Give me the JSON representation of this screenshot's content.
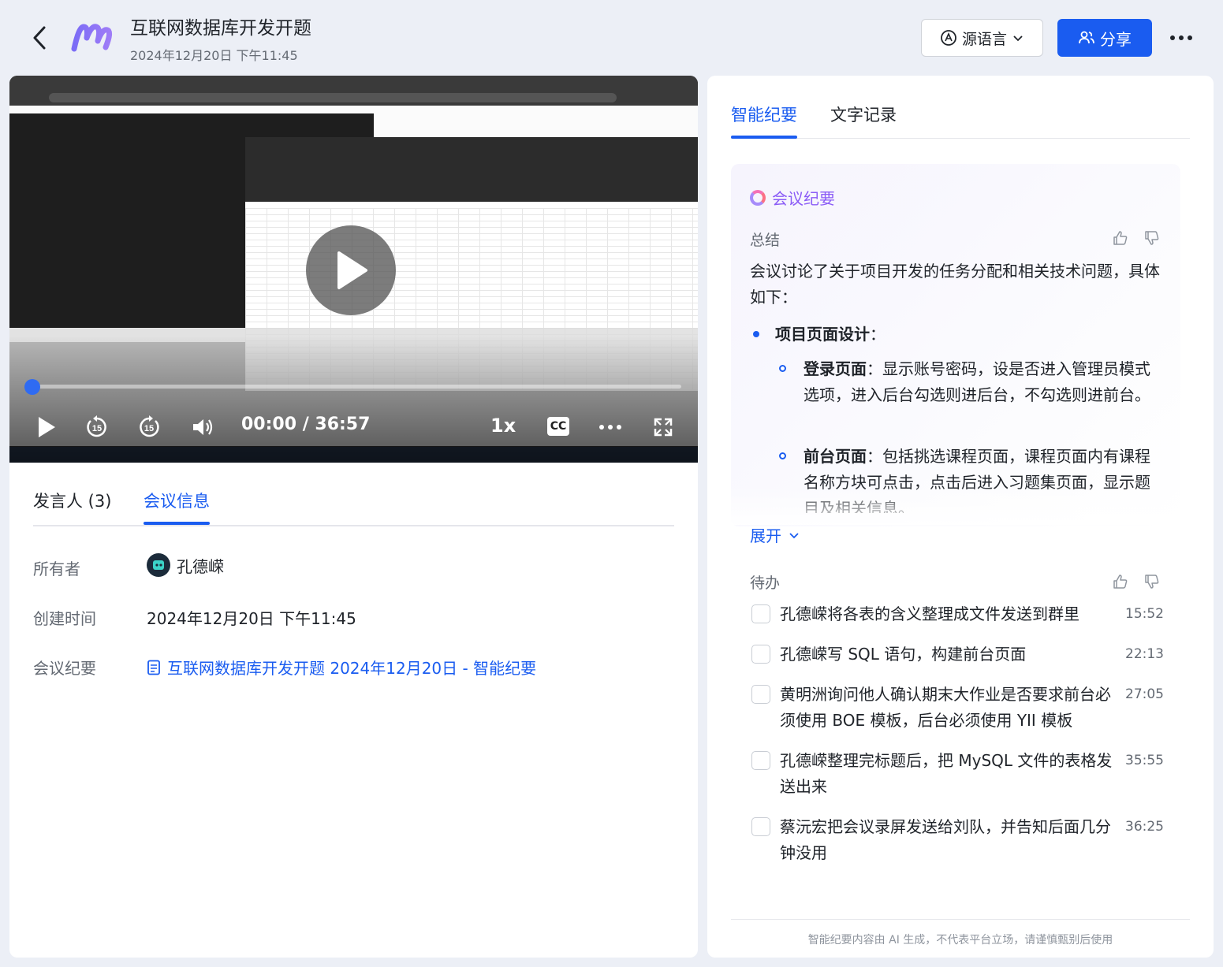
{
  "header": {
    "title": "互联网数据库开发开题",
    "subtitle": "2024年12月20日 下午11:45",
    "lang_button": "源语言",
    "share_button": "分享"
  },
  "video": {
    "time_display": "00:00 / 36:57",
    "speed": "1x",
    "cc_label": "CC",
    "progress": 0,
    "skip_seconds": "15"
  },
  "left_tabs": {
    "speakers": "发言人 (3)",
    "meeting_info": "会议信息"
  },
  "meeting_info": {
    "owner_label": "所有者",
    "owner_name": "孔德嵘",
    "created_label": "创建时间",
    "created_value": "2024年12月20日 下午11:45",
    "minutes_label": "会议纪要",
    "minutes_link": "互联网数据库开发开题 2024年12月20日 - 智能纪要"
  },
  "right_tabs": {
    "smart_minutes": "智能纪要",
    "transcript": "文字记录"
  },
  "summary": {
    "heading": "会议纪要",
    "section_label": "总结",
    "intro": "会议讨论了关于项目开发的任务分配和相关技术问题，具体如下：",
    "bullet_title": "项目页面设计",
    "bullet_suffix": "：",
    "sub1_title": "登录页面",
    "sub1_text": "：显示账号密码，设是否进入管理员模式选项，进入后台勾选则进后台，不勾选则进前台。",
    "sub2_title": "前台页面",
    "sub2_text": "：包括挑选课程页面，课程页面内有课程名称方块可点击，点击后进入习题集页面，显示题目及相关信息。",
    "expand": "展开"
  },
  "todos": {
    "section_label": "待办",
    "items": [
      {
        "text": "孔德嵘将各表的含义整理成文件发送到群里",
        "time": "15:52"
      },
      {
        "text": "孔德嵘写 SQL 语句，构建前台页面",
        "time": "22:13"
      },
      {
        "text": "黄明洲询问他人确认期末大作业是否要求前台必须使用 BOE 模板，后台必须使用 YII 模板",
        "time": "27:05"
      },
      {
        "text": "孔德嵘整理完标题后，把 MySQL 文件的表格发送出来",
        "time": "35:55"
      },
      {
        "text": "蔡沅宏把会议录屏发送给刘队，并告知后面几分钟没用",
        "time": "36:25"
      }
    ]
  },
  "footer_note": "智能纪要内容由 AI 生成，不代表平台立场，请谨慎甄别后使用",
  "colors": {
    "accent": "#1a5cf0",
    "background": "#eceff6"
  }
}
